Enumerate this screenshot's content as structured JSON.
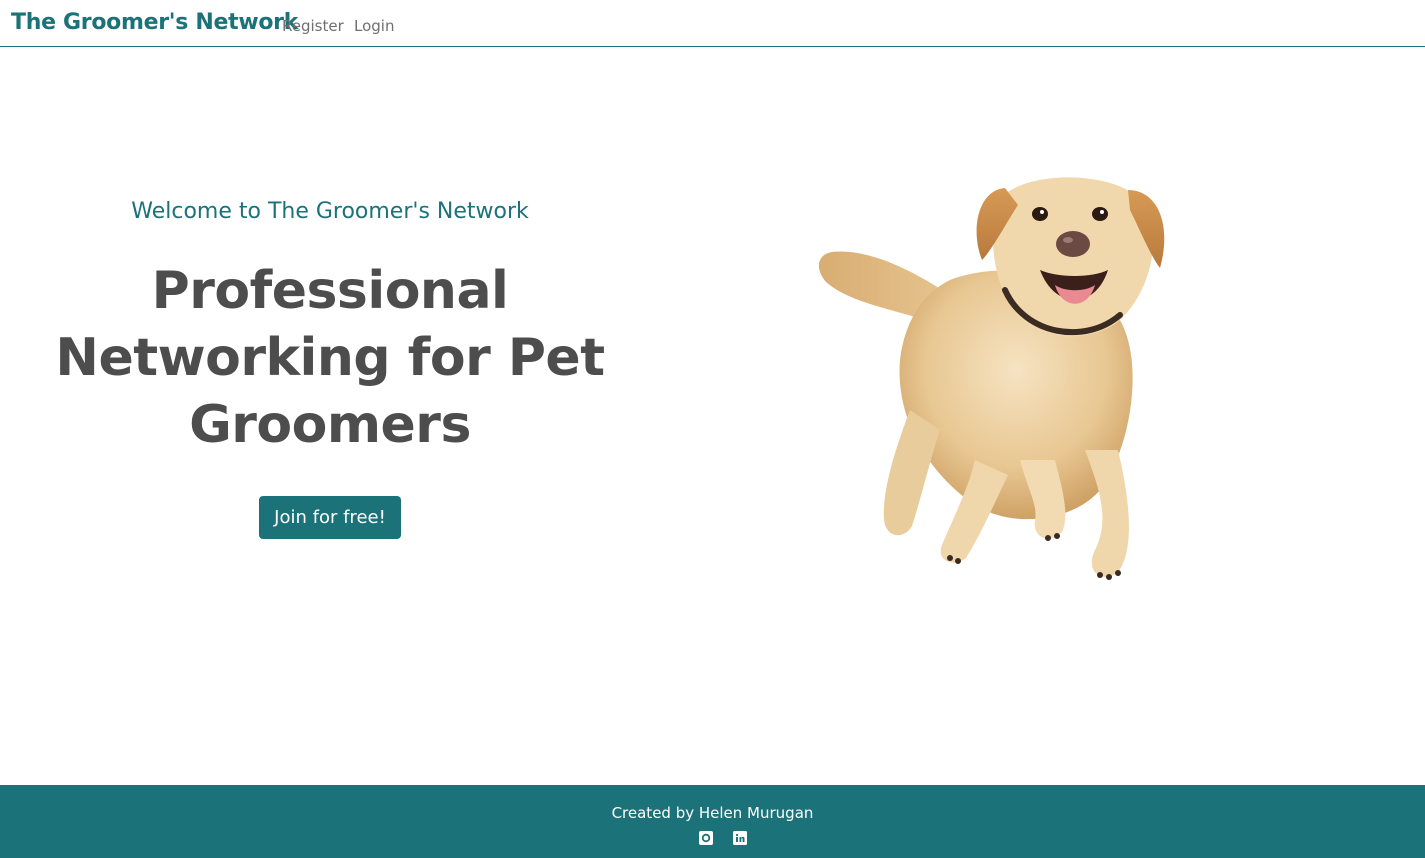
{
  "navbar": {
    "brand": "The Groomer's Network",
    "links": [
      {
        "label": "Register"
      },
      {
        "label": "Login"
      }
    ]
  },
  "hero": {
    "welcome": "Welcome to The Groomer's Network",
    "headline": "Professional Networking for Pet Groomers",
    "cta_label": "Join for free!",
    "image_subject": "jumping labrador retriever"
  },
  "footer": {
    "credit": "Created by Helen Murugan",
    "social_icons": [
      "github-icon",
      "linkedin-icon"
    ]
  },
  "colors": {
    "brand": "#1b7279",
    "headline": "#4d4d4d",
    "nav_link": "#6f6f6f",
    "background": "#ffffff"
  }
}
